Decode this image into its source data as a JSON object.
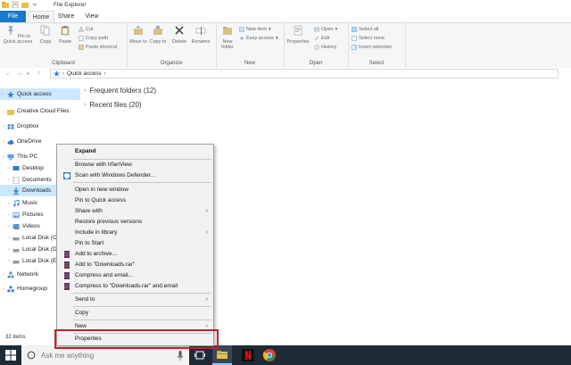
{
  "window": {
    "title": "File Explorer"
  },
  "tabs": {
    "file": "File",
    "home": "Home",
    "share": "Share",
    "view": "View"
  },
  "ribbon": {
    "clipboard": {
      "pin": "Pin to Quick access",
      "copy": "Copy",
      "paste": "Paste",
      "cut": "Cut",
      "copy_path": "Copy path",
      "paste_shortcut": "Paste shortcut",
      "label": "Clipboard"
    },
    "organize": {
      "move_to": "Move to",
      "copy_to": "Copy to",
      "delete": "Delete",
      "rename": "Rename",
      "label": "Organize"
    },
    "new": {
      "new_folder": "New folder",
      "new_item": "New item",
      "easy_access": "Easy access",
      "label": "New"
    },
    "open": {
      "properties": "Properties",
      "open": "Open",
      "edit": "Edit",
      "history": "History",
      "label": "Open"
    },
    "select": {
      "select_all": "Select all",
      "select_none": "Select none",
      "invert": "Invert selection",
      "label": "Select"
    }
  },
  "address": {
    "path": "Quick access"
  },
  "nav": {
    "items": [
      {
        "label": "Quick access"
      },
      {
        "label": "Creative Cloud Files"
      },
      {
        "label": "Dropbox"
      },
      {
        "label": "OneDrive"
      },
      {
        "label": "This PC"
      },
      {
        "label": "Desktop"
      },
      {
        "label": "Documents"
      },
      {
        "label": "Downloads"
      },
      {
        "label": "Music"
      },
      {
        "label": "Pictures"
      },
      {
        "label": "Videos"
      },
      {
        "label": "Local Disk (C"
      },
      {
        "label": "Local Disk (D"
      },
      {
        "label": "Local Disk (E"
      },
      {
        "label": "Network"
      },
      {
        "label": "Homegroup"
      }
    ]
  },
  "content": {
    "frequent": "Frequent folders (12)",
    "recent": "Recent files (20)"
  },
  "status": {
    "count": "32 items"
  },
  "taskbar": {
    "search_placeholder": "Ask me anything"
  },
  "context_menu": {
    "items": [
      {
        "label": "Expand"
      },
      {
        "label": "Browse with IrfanView"
      },
      {
        "label": "Scan with Windows Defender..."
      },
      {
        "label": "Open in new window"
      },
      {
        "label": "Pin to Quick access"
      },
      {
        "label": "Share with"
      },
      {
        "label": "Restore previous versions"
      },
      {
        "label": "Include in library"
      },
      {
        "label": "Pin to Start"
      },
      {
        "label": "Add to archive..."
      },
      {
        "label": "Add to \"Downloads.rar\""
      },
      {
        "label": "Compress and email..."
      },
      {
        "label": "Compress to \"Downloads.rar\" and email"
      },
      {
        "label": "Send to"
      },
      {
        "label": "Copy"
      },
      {
        "label": "New"
      },
      {
        "label": "Properties"
      }
    ]
  },
  "colors": {
    "accent": "#1979ca",
    "selection": "#cce8ff",
    "highlight_box": "#c3242b",
    "taskbar": "#1e2a36"
  }
}
